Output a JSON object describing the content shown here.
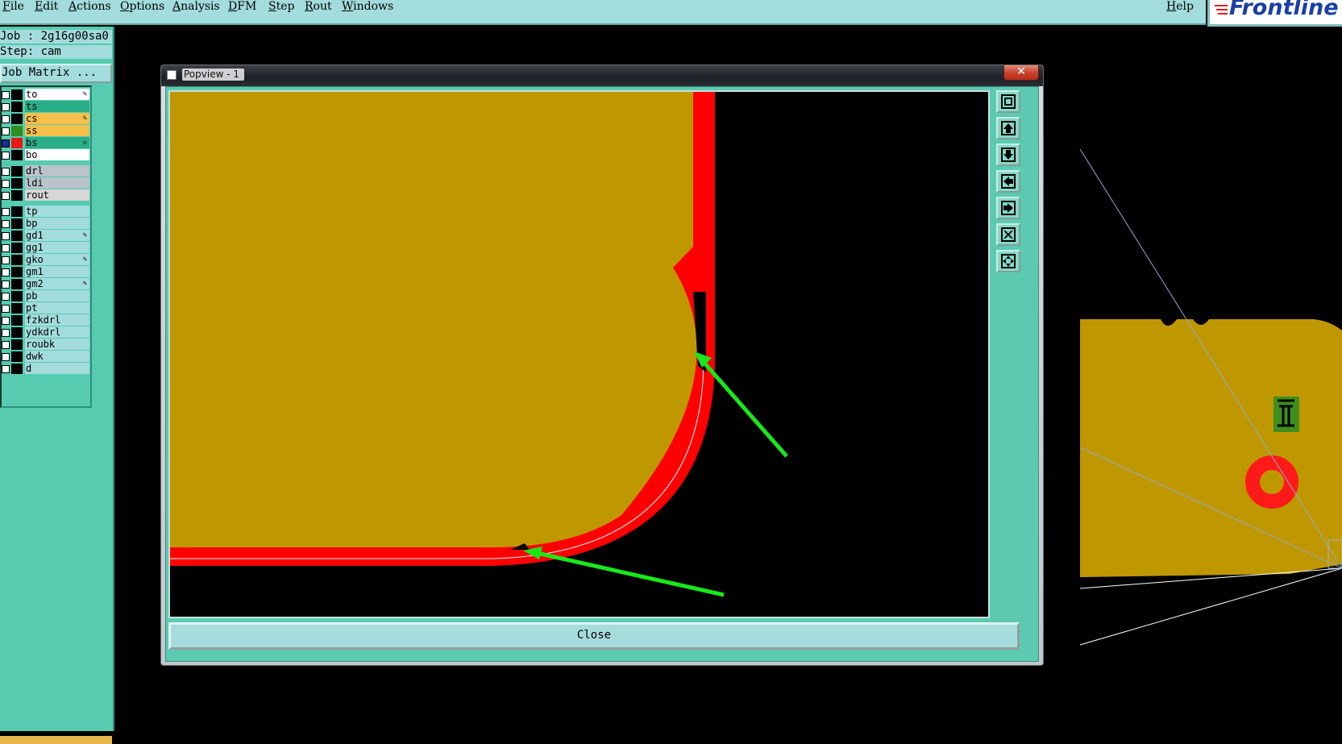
{
  "menubar": {
    "items": [
      "File",
      "Edit",
      "Actions",
      "Options",
      "Analysis",
      "DFM",
      "Step",
      "Rout",
      "Windows"
    ],
    "help": "Help",
    "logo": "Frontline"
  },
  "left_panel": {
    "job_line": "Job : 2g16g00sa0",
    "step_line": "Step: cam",
    "job_matrix_button": "Job Matrix ...",
    "layers": [
      {
        "name": "to",
        "color": "#ffffff",
        "swatch": "#000000",
        "mark": "✎"
      },
      {
        "name": "ts",
        "color": "#2aae88",
        "swatch": "#000000",
        "mark": ""
      },
      {
        "name": "cs",
        "color": "#f5bf4a",
        "swatch": "#000000",
        "mark": "✎"
      },
      {
        "name": "ss",
        "color": "#f5bf4a",
        "swatch": "#2f8f1e",
        "mark": ""
      },
      {
        "name": "bs",
        "color": "#2aae88",
        "swatch": "#e81818",
        "mark": "▫",
        "active": true
      },
      {
        "name": "bo",
        "color": "#ffffff",
        "swatch": "#000000",
        "mark": ""
      },
      {
        "name": "drl",
        "color": "#b9c3c9",
        "swatch": "#000000",
        "mark": ""
      },
      {
        "name": "ldi",
        "color": "#b9c3c9",
        "swatch": "#000000",
        "mark": ""
      },
      {
        "name": "rout",
        "color": "#d6d6d6",
        "swatch": "#000000",
        "mark": ""
      },
      {
        "name": "tp",
        "color": "#a3dcdc",
        "swatch": "#000000",
        "mark": ""
      },
      {
        "name": "bp",
        "color": "#a3dcdc",
        "swatch": "#000000",
        "mark": ""
      },
      {
        "name": "gd1",
        "color": "#a3dcdc",
        "swatch": "#000000",
        "mark": "✎"
      },
      {
        "name": "gg1",
        "color": "#a3dcdc",
        "swatch": "#000000",
        "mark": ""
      },
      {
        "name": "gko",
        "color": "#a3dcdc",
        "swatch": "#000000",
        "mark": "✎"
      },
      {
        "name": "gm1",
        "color": "#a3dcdc",
        "swatch": "#000000",
        "mark": ""
      },
      {
        "name": "gm2",
        "color": "#a3dcdc",
        "swatch": "#000000",
        "mark": "✎"
      },
      {
        "name": "pb",
        "color": "#a3dcdc",
        "swatch": "#000000",
        "mark": ""
      },
      {
        "name": "pt",
        "color": "#a3dcdc",
        "swatch": "#000000",
        "mark": ""
      },
      {
        "name": "fzkdrl",
        "color": "#a3dcdc",
        "swatch": "#000000",
        "mark": ""
      },
      {
        "name": "ydkdrl",
        "color": "#a3dcdc",
        "swatch": "#000000",
        "mark": ""
      },
      {
        "name": "roubk",
        "color": "#a3dcdc",
        "swatch": "#000000",
        "mark": ""
      },
      {
        "name": "dwk",
        "color": "#a3dcdc",
        "swatch": "#000000",
        "mark": ""
      },
      {
        "name": "d",
        "color": "#a3dcdc",
        "swatch": "#000000",
        "mark": ""
      }
    ]
  },
  "popview": {
    "title": "Popview - 1",
    "close_x": "✕",
    "close_button": "Close",
    "tools": [
      "zoom-home-icon",
      "pan-up-icon",
      "pan-down-icon",
      "pan-left-icon",
      "pan-right-icon",
      "zoom-in-icon",
      "zoom-out-icon"
    ]
  },
  "colors": {
    "copper": "#bf9800",
    "soldermask": "#ff0000",
    "annotation_arrow": "#18e81a",
    "panel_teal": "#57cbb0",
    "menu_cyan": "#a3dcdc"
  }
}
